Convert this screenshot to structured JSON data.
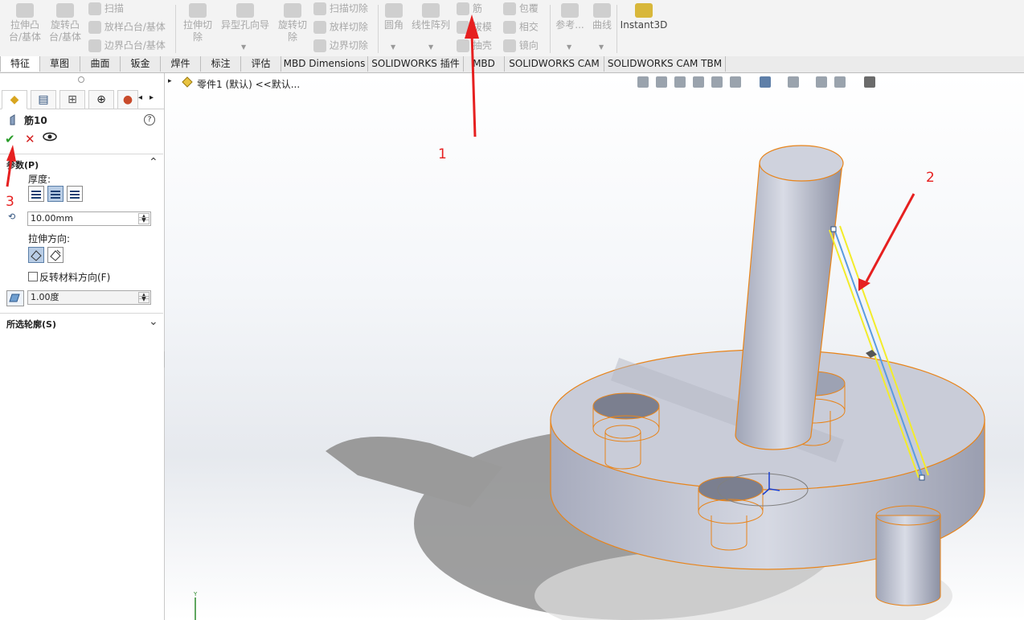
{
  "ribbon": {
    "extrude_boss": "拉伸凸\n台/基体",
    "revolve_boss": "旋转凸\n台/基体",
    "sweep": "扫描",
    "loft_boss": "放样凸台/基体",
    "boundary_boss": "边界凸台/基体",
    "extrude_cut": "拉伸切\n除",
    "hole_wizard": "异型孔向导",
    "revolve_cut": "旋转切\n除",
    "sweep_cut": "扫描切除",
    "loft_cut": "放样切除",
    "boundary_cut": "边界切除",
    "fillet": "圆角",
    "linear_pattern": "线性阵列",
    "rib": "筋",
    "draft": "拔模",
    "shell": "抽壳",
    "wrap": "包覆",
    "intersect": "相交",
    "mirror": "镜向",
    "reference": "参考...",
    "curves": "曲线",
    "instant3d": "Instant3D"
  },
  "tabs": [
    "特征",
    "草图",
    "曲面",
    "钣金",
    "焊件",
    "标注",
    "评估",
    "MBD Dimensions",
    "SOLIDWORKS 插件",
    "MBD",
    "SOLIDWORKS CAM",
    "SOLIDWORKS CAM TBM"
  ],
  "tree": {
    "part_label": "零件1 (默认) <<默认..."
  },
  "property_manager": {
    "feature_title": "筋10",
    "help": "?",
    "ok": "✔",
    "cancel": "✕",
    "params_header": "参数(P)",
    "thickness_label": "厚度:",
    "thickness_value": "10.00mm",
    "extrude_dir_label": "拉伸方向:",
    "flip_material": "反转材料方向(F)",
    "draft_value": "1.00度",
    "selected_contours": "所选轮廓(S)"
  },
  "annotations": [
    "1",
    "2",
    "3"
  ],
  "colors": {
    "annotation": "#e62020",
    "selection_edge": "#e8841a",
    "sketch_yellow": "#f3ec2a",
    "sketch_blue": "#5a9be0",
    "ok_green": "#2a9d2a",
    "cancel_red": "#d42020"
  }
}
